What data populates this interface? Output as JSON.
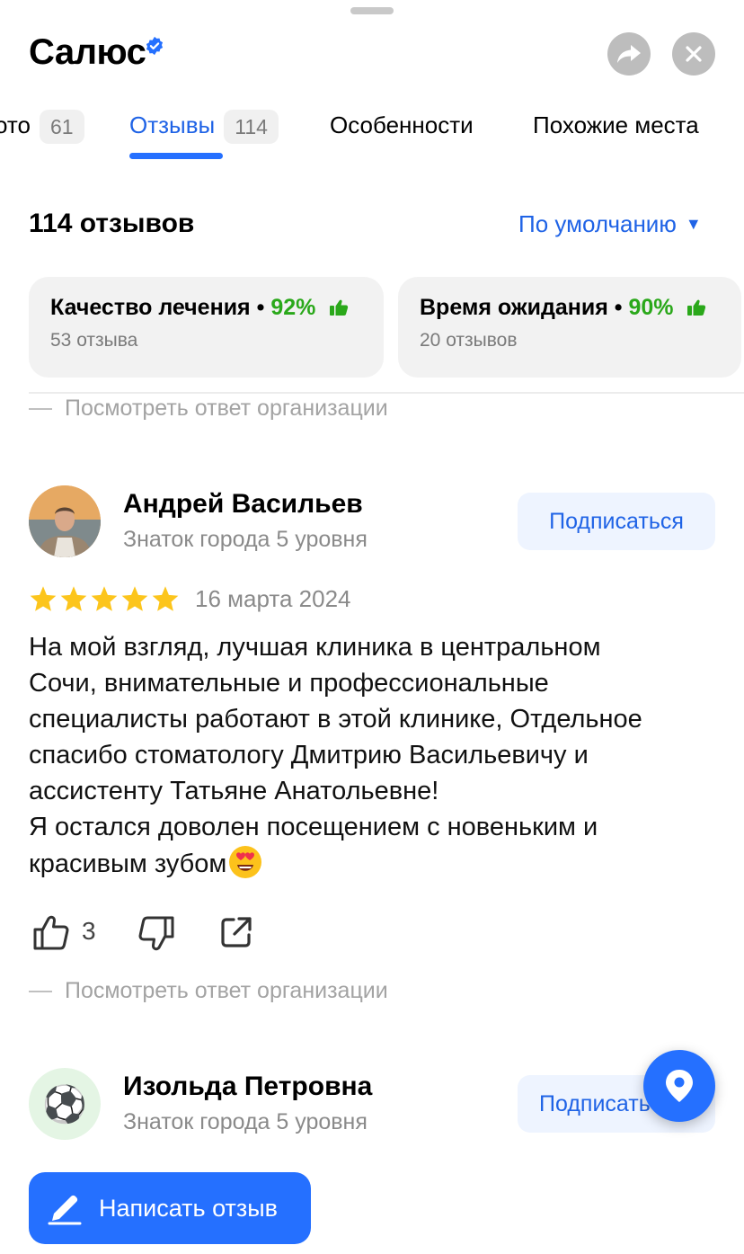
{
  "header": {
    "title": "Салюс",
    "verified_icon": "verified-badge-icon",
    "share_icon": "share-arrow-icon",
    "close_icon": "close-icon"
  },
  "tabs": [
    {
      "label": "Фото",
      "visible_label": "ото",
      "count": "61"
    },
    {
      "label": "Отзывы",
      "count": "114",
      "active": true
    },
    {
      "label": "Особенности"
    },
    {
      "label": "Похожие места"
    }
  ],
  "reviews_summary": {
    "count_title": "114 отзывов",
    "sort_label": "По умолчанию",
    "sort_icon": "triangle-down-icon"
  },
  "aspects": [
    {
      "name": "Качество лечения",
      "separator": "•",
      "percent": "92%",
      "sub": "53 отзыва"
    },
    {
      "name": "Время ожидания",
      "separator": "•",
      "percent": "90%",
      "sub": "20 отзывов"
    }
  ],
  "org_reply_label": "Посмотреть ответ организации",
  "reviews": [
    {
      "author": "Андрей Васильев",
      "level": "Знаток города 5 уровня",
      "subscribe": "Подписаться",
      "rating": 5,
      "date": "16 марта 2024",
      "text_lines": [
        "На мой взгляд, лучшая клиника в центральном",
        "Сочи, внимательные и профессиональные",
        "специалисты работают в этой клинике, Отдельное",
        "спасибо стоматологу Дмитрию Васильевичу и",
        "ассистенту Татьяне Анатольевне!",
        "Я остался доволен посещением с новеньким и",
        "красивым зубом"
      ],
      "likes": "3"
    },
    {
      "author": "Изольда Петровна",
      "level": "Знаток города 5 уровня",
      "subscribe": "Подписаться",
      "avatar_glyph": "⚽"
    }
  ],
  "fab_icon": "map-pin-icon",
  "write_review": {
    "label": "Написать отзыв",
    "icon": "pencil-icon"
  },
  "colors": {
    "accent": "#2570ff",
    "link": "#1f63e6",
    "positive": "#2aa81a",
    "star": "#fcc51c"
  }
}
